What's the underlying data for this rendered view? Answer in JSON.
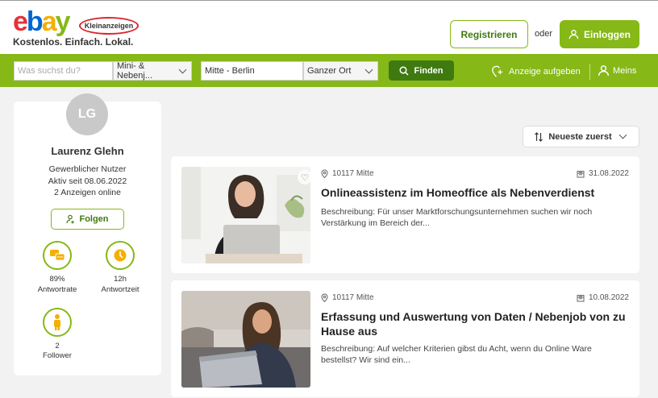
{
  "header": {
    "logo_letters": [
      "e",
      "b",
      "a",
      "y"
    ],
    "logo_badge": "Kleinanzeigen",
    "tagline": "Kostenlos. Einfach. Lokal.",
    "register_label": "Registrieren",
    "or_label": "oder",
    "login_label": "Einloggen"
  },
  "search": {
    "query_placeholder": "Was suchst du?",
    "category_value": "Mini- & Nebenj...",
    "location_value": "Mitte - Berlin",
    "radius_value": "Ganzer Ort",
    "find_label": "Finden",
    "post_ad_label": "Anzeige aufgeben",
    "meins_label": "Meins"
  },
  "profile": {
    "initials": "LG",
    "name": "Laurenz Glehn",
    "user_type": "Gewerblicher Nutzer",
    "active_since": "Aktiv seit 08.06.2022",
    "ads_online": "2 Anzeigen online",
    "follow_label": "Folgen",
    "stats": [
      {
        "value": "89%",
        "label": "Antwortrate"
      },
      {
        "value": "12h",
        "label": "Antwortzeit"
      },
      {
        "value": "2",
        "label": "Follower"
      }
    ]
  },
  "sort": {
    "label": "Neueste zuerst"
  },
  "listings": [
    {
      "location": "10117 Mitte",
      "date": "31.08.2022",
      "title": "Onlineassistenz im Homeoffice als Nebenverdienst",
      "description": "Beschreibung: Für unser Marktforschungsunternehmen suchen wir noch Verstärkung im Bereich der..."
    },
    {
      "location": "10117 Mitte",
      "date": "10.08.2022",
      "title": "Erfassung und Auswertung von Daten / Nebenjob von zu Hause aus",
      "description": "Beschreibung: Auf welcher Kriterien gibst du Acht, wenn du Online Ware bestellst? Wir sind ein..."
    }
  ],
  "colors": {
    "brand_green": "#86b817",
    "dark_green": "#3f7a10"
  }
}
